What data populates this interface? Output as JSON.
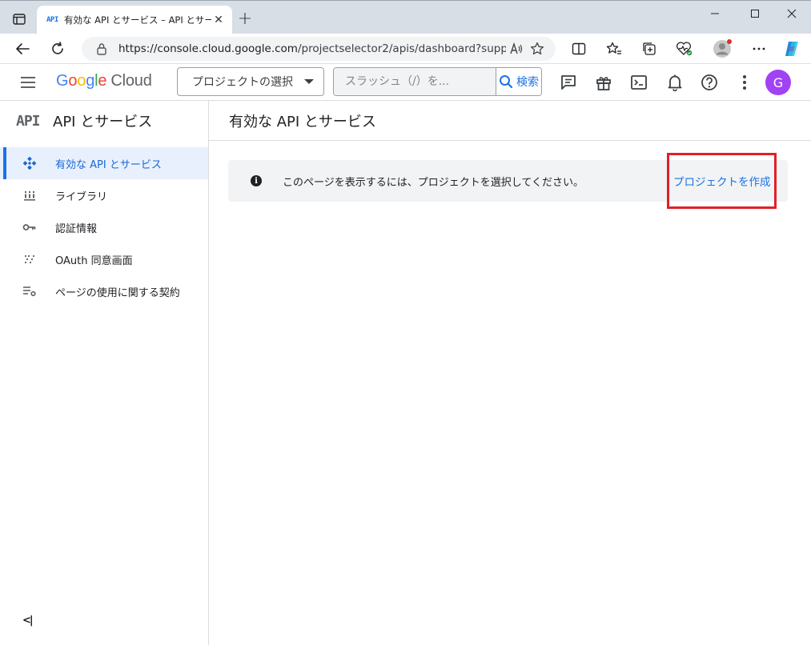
{
  "browser": {
    "tab_favicon": "API",
    "tab_title": "有効な API とサービス – API とサービス",
    "tab_close": "✕",
    "new_tab": "+",
    "url_host": "https://console.cloud.google.com",
    "url_path": "/projectselector2/apis/dashboard?supp..."
  },
  "header": {
    "logo_google": "Google",
    "logo_cloud": "Cloud",
    "project_selector": "プロジェクトの選択",
    "search_placeholder": "スラッシュ（/）を...",
    "search_button": "検索",
    "avatar_initial": "G"
  },
  "sidebar": {
    "api_logo": "API",
    "title": "API とサービス",
    "items": [
      {
        "label": "有効な API とサービス",
        "icon": "api-diamond-icon",
        "active": true
      },
      {
        "label": "ライブラリ",
        "icon": "library-icon",
        "active": false
      },
      {
        "label": "認証情報",
        "icon": "key-icon",
        "active": false
      },
      {
        "label": "OAuth 同意画面",
        "icon": "oauth-dots-icon",
        "active": false
      },
      {
        "label": "ページの使用に関する契約",
        "icon": "settings-list-icon",
        "active": false
      }
    ],
    "collapse": "<|"
  },
  "main": {
    "title": "有効な API とサービス",
    "banner_message": "このページを表示するには、プロジェクトを選択してください。",
    "create_project_link": "プロジェクトを作成"
  },
  "colors": {
    "accent": "#1a73e8",
    "highlight_box": "#e21f26",
    "active_bg": "#e8f0fe",
    "avatar": "#a142f4"
  }
}
